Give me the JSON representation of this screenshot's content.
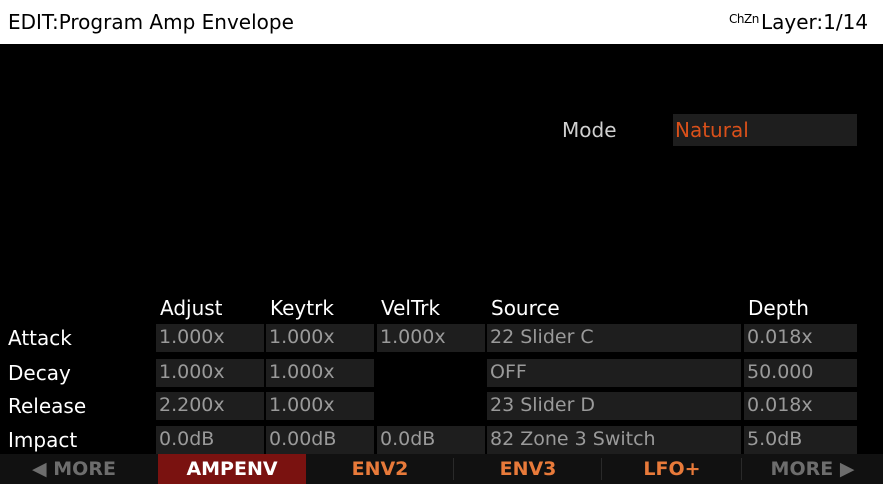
{
  "header": {
    "title": "EDIT:Program Amp Envelope",
    "chan_icon": "ChZn",
    "layer": "Layer:1/14"
  },
  "mode": {
    "label": "Mode",
    "value": "Natural"
  },
  "columns": {
    "adjust": "Adjust",
    "keytrk": "Keytrk",
    "veltrk": "VelTrk",
    "source": "Source",
    "depth": "Depth"
  },
  "rows": [
    {
      "label": "Attack",
      "adjust": "1.000x",
      "keytrk": "1.000x",
      "veltrk": "1.000x",
      "source": "22 Slider C",
      "depth": "0.018x"
    },
    {
      "label": "Decay",
      "adjust": "1.000x",
      "keytrk": "1.000x",
      "veltrk": "",
      "source": "OFF",
      "depth": "50.000"
    },
    {
      "label": "Release",
      "adjust": "2.200x",
      "keytrk": "1.000x",
      "veltrk": "",
      "source": "23 Slider D",
      "depth": "0.018x"
    },
    {
      "label": "Impact",
      "adjust": "0.0dB",
      "keytrk": "0.00dB",
      "veltrk": "0.0dB",
      "source": "82 Zone 3 Switch",
      "depth": "5.0dB"
    }
  ],
  "softbuttons": [
    {
      "label": "◀ MORE"
    },
    {
      "label": "AMPENV"
    },
    {
      "label": "ENV2"
    },
    {
      "label": "ENV3"
    },
    {
      "label": "LFO+"
    },
    {
      "label": "MORE ▶"
    }
  ],
  "colors": {
    "accent": "#d9501a",
    "active_tab": "#7a1210",
    "tab_text": "#e87a3a",
    "field_bg": "#1e1e1e"
  }
}
